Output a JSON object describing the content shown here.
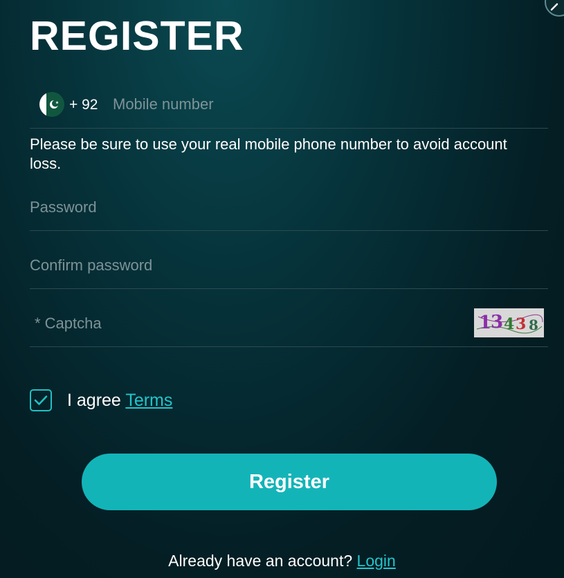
{
  "form": {
    "title": "REGISTER",
    "phone": {
      "country_flag": "pakistan-flag-icon",
      "dial_code": "+ 92",
      "placeholder": "Mobile number",
      "value": ""
    },
    "hint": "Please be sure to use your real mobile phone number to avoid account loss.",
    "password": {
      "placeholder": "Password",
      "value": ""
    },
    "confirm_password": {
      "placeholder": "Confirm password",
      "value": ""
    },
    "captcha": {
      "placeholder": "* Captcha",
      "value": "",
      "code": "13438"
    },
    "agree": {
      "checked": true,
      "label": "I agree ",
      "terms_link": "Terms"
    },
    "submit_label": "Register",
    "footer": {
      "text": "Already have an account? ",
      "login_link": "Login"
    }
  },
  "colors": {
    "accent": "#13b4b8",
    "link": "#22c5cc",
    "background": "#041e24"
  }
}
